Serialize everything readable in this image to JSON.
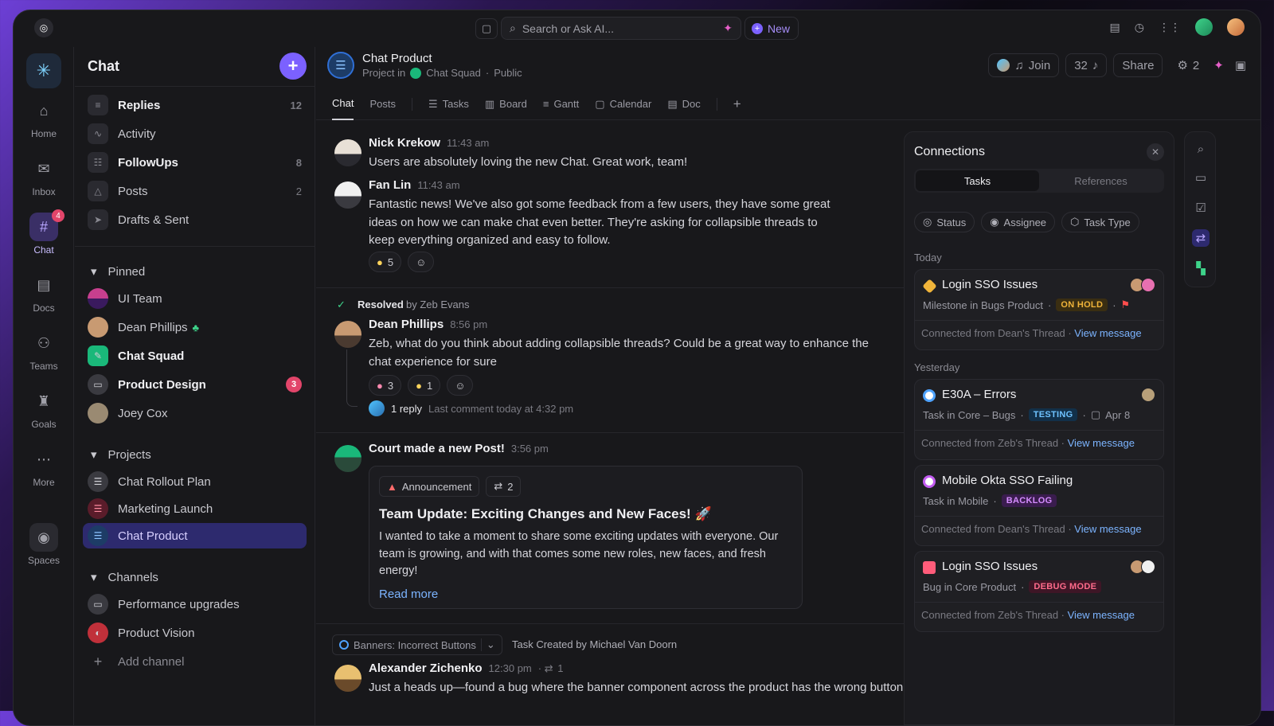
{
  "topbar": {
    "search_placeholder": "Search or Ask AI...",
    "new_label": "New"
  },
  "rail": [
    {
      "label": "Home"
    },
    {
      "label": "Inbox"
    },
    {
      "label": "Chat",
      "badge": "4"
    },
    {
      "label": "Docs"
    },
    {
      "label": "Teams"
    },
    {
      "label": "Goals"
    },
    {
      "label": "More"
    },
    {
      "label": "Spaces"
    }
  ],
  "sidebar": {
    "title": "Chat",
    "items": [
      {
        "label": "Replies",
        "count": "12"
      },
      {
        "label": "Activity",
        "count": ""
      },
      {
        "label": "FollowUps",
        "count": "8"
      },
      {
        "label": "Posts",
        "count": "2"
      },
      {
        "label": "Drafts & Sent",
        "count": ""
      }
    ],
    "pinned_label": "Pinned",
    "pinned": [
      {
        "label": "UI Team"
      },
      {
        "label": "Dean Phillips"
      },
      {
        "label": "Chat Squad"
      },
      {
        "label": "Product Design",
        "badge": "3"
      },
      {
        "label": "Joey Cox"
      }
    ],
    "projects_label": "Projects",
    "projects": [
      {
        "label": "Chat Rollout Plan"
      },
      {
        "label": "Marketing Launch"
      },
      {
        "label": "Chat Product"
      }
    ],
    "channels_label": "Channels",
    "channels": [
      {
        "label": "Performance upgrades"
      },
      {
        "label": "Product Vision"
      },
      {
        "label": "Add channel"
      }
    ]
  },
  "channel": {
    "title": "Chat Product",
    "sub_prefix": "Project in",
    "sub_space": "Chat Squad",
    "sub_visibility": "Public",
    "join_label": "Join",
    "member_count": "32",
    "share_label": "Share",
    "ai_count": "2",
    "tabs": [
      "Chat",
      "Posts",
      "Tasks",
      "Board",
      "Gantt",
      "Calendar",
      "Doc"
    ]
  },
  "messages": {
    "m1": {
      "name": "Nick Krekow",
      "time": "11:43 am",
      "text": "Users are absolutely loving the new Chat. Great work, team!"
    },
    "m2": {
      "name": "Fan Lin",
      "time": "11:43 am",
      "text": "Fantastic news! We've also got some feedback from a few users, they have some great ideas on how we can make chat even better. They're asking for collapsible threads to keep everything organized and easy to follow.",
      "reaction_count": "5"
    },
    "resolved": {
      "label": "Resolved",
      "by": "by Zeb Evans"
    },
    "m3": {
      "name": "Dean Phillips",
      "time": "8:56 pm",
      "text": "Zeb, what do you think about adding collapsible threads? Could be a great way to enhance the chat experience for sure",
      "reaction1": "3",
      "reaction2": "1",
      "reply_label": "1 reply",
      "reply_meta": "Last comment today at 4:32 pm"
    },
    "m4": {
      "name": "Court made a new Post!",
      "time": "3:56 pm",
      "tag": "Announcement",
      "tag_count": "2",
      "post_title": "Team Update: Exciting Changes and New Faces! 🚀",
      "post_text": "I wanted to take a moment to share some exciting updates with everyone. Our team is growing, and with that comes some new roles, new faces, and fresh energy!",
      "read_more": "Read more"
    },
    "task_banner": {
      "chip": "Banners: Incorrect Buttons",
      "text": "Task Created by Michael Van Doorn"
    },
    "m5": {
      "name": "Alexander Zichenko",
      "time": "12:30 pm",
      "count": "1",
      "text": "Just a heads up—found a bug where the banner component across the product has the wrong button"
    }
  },
  "connections": {
    "title": "Connections",
    "seg": [
      "Tasks",
      "References"
    ],
    "filters": [
      "Status",
      "Assignee",
      "Task Type"
    ],
    "today_label": "Today",
    "yesterday_label": "Yesterday",
    "cards": [
      {
        "title": "Login SSO Issues",
        "sub": "Milestone in Bugs Product",
        "tag": "ON HOLD",
        "foot": "Connected from Dean's Thread",
        "link": "View message",
        "tag_bg": "#3a2e12",
        "tag_fg": "#f0b43a",
        "icon_color": "#f0b43a"
      },
      {
        "title": "E30A – Errors",
        "sub": "Task in Core – Bugs",
        "tag": "TESTING",
        "date": "Apr 8",
        "foot": "Connected from Zeb's Thread",
        "link": "View message",
        "tag_bg": "#123049",
        "tag_fg": "#6fc3ff",
        "icon_color": "#4fa3ff"
      },
      {
        "title": "Mobile Okta SSO Failing",
        "sub": "Task in Mobile",
        "tag": "BACKLOG",
        "foot": "Connected from Dean's Thread",
        "link": "View message",
        "tag_bg": "#3a1c4e",
        "tag_fg": "#d58cff",
        "icon_color": "#c25cf0"
      },
      {
        "title": "Login SSO Issues",
        "sub": "Bug in Core Product",
        "tag": "DEBUG MODE",
        "foot": "Connected from Zeb's Thread",
        "link": "View message",
        "tag_bg": "#3e1626",
        "tag_fg": "#ff6b8b",
        "icon_color": "#ff5c7a"
      }
    ]
  }
}
